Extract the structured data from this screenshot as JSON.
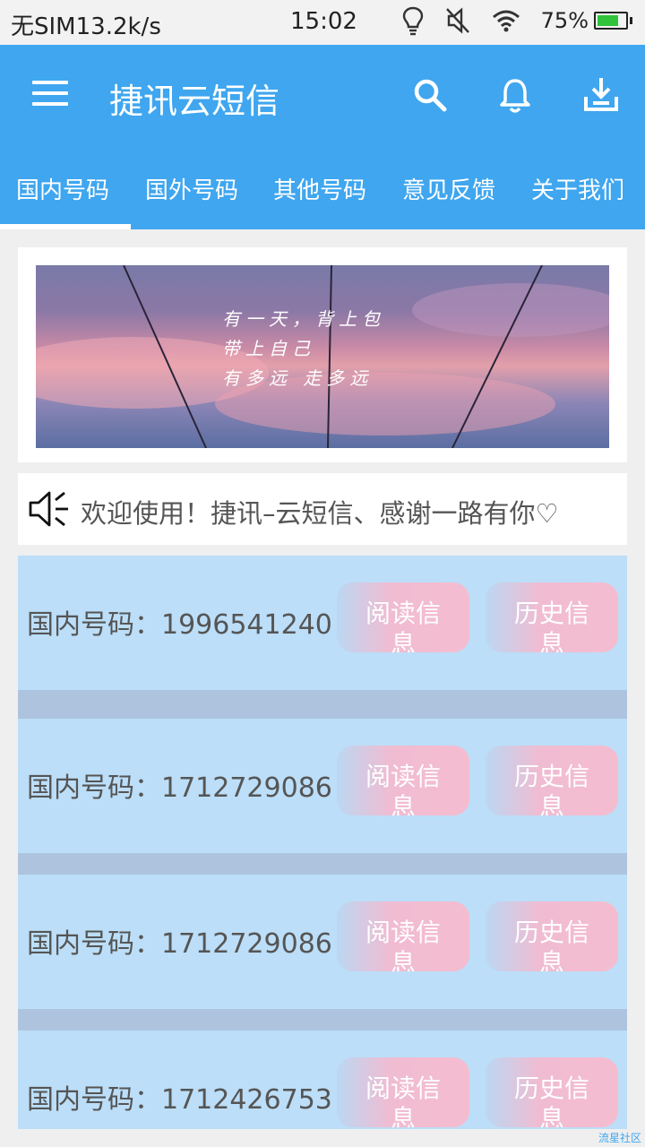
{
  "status_bar": {
    "carrier": "无SIM",
    "speed": "13.2k/s",
    "time": "15:02",
    "battery": "75%",
    "battery_level": 0.75
  },
  "app_bar": {
    "title": "捷讯云短信",
    "color": "#3fa6ef"
  },
  "tabs": [
    {
      "label": "国内号码",
      "active": true
    },
    {
      "label": "国外号码"
    },
    {
      "label": "其他号码"
    },
    {
      "label": "意见反馈"
    },
    {
      "label": "关于我们"
    }
  ],
  "banner": {
    "lines": [
      "有一天，背上包",
      "带上自己",
      "有多远 走多远"
    ]
  },
  "notice": {
    "text": "欢迎使用！捷讯–云短信、感谢一路有你♡"
  },
  "numbers": [
    {
      "label": "国内号码：1996541240",
      "read_label": "阅读信息",
      "history_label": "历史信息"
    },
    {
      "label": "国内号码：1712729086",
      "read_label": "阅读信息",
      "history_label": "历史信息"
    },
    {
      "label": "国内号码：1712729086",
      "read_label": "阅读信息",
      "history_label": "历史信息"
    },
    {
      "label": "国内号码：1712426753",
      "read_label": "阅读信息",
      "history_label": "历史信息"
    }
  ],
  "watermark": "流星社区"
}
